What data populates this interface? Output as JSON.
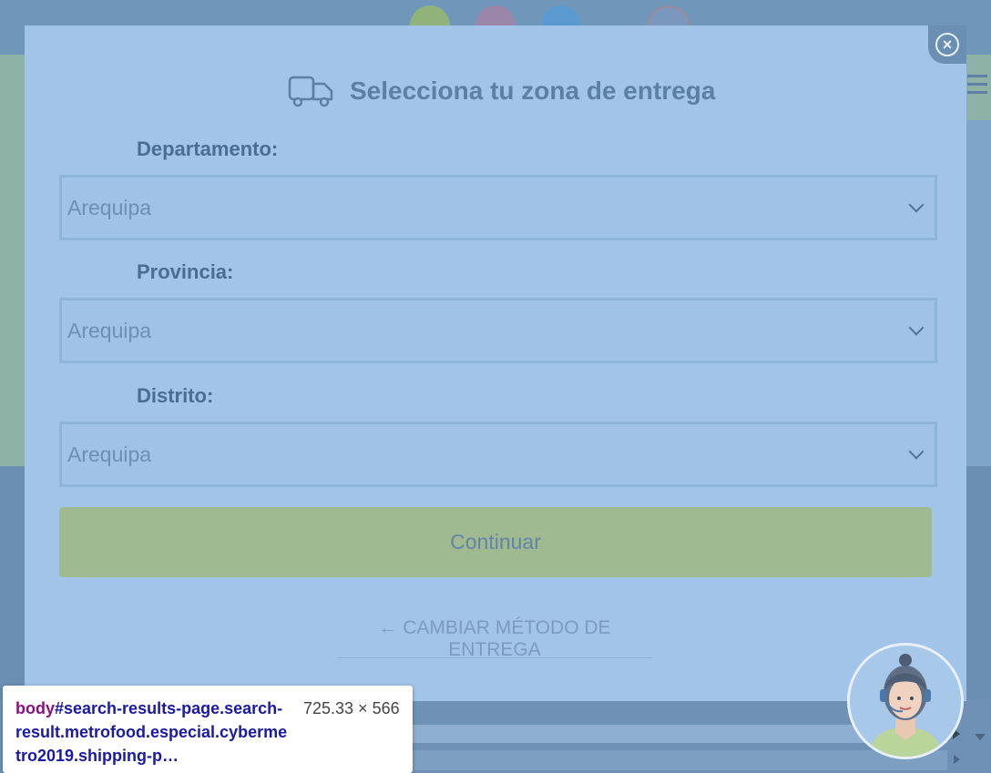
{
  "modal": {
    "title": "Selecciona tu zona de entrega",
    "fields": [
      {
        "label": "Departamento:",
        "value": "Arequipa"
      },
      {
        "label": "Provincia:",
        "value": "Arequipa"
      },
      {
        "label": "Distrito:",
        "value": "Arequipa"
      }
    ],
    "continue_label": "Continuar",
    "change_method_label": "← CAMBIAR MÉTODO DE ENTREGA"
  },
  "devtools_tooltip": {
    "tag": "body",
    "selector": "#search-results-page.search-result.metrofood.especial.cybermetro2019.shipping-p…",
    "dimensions": "725.33 × 566"
  },
  "colors": {
    "overlay_bg": "#6b8fb3",
    "modal_bg": "#a1c4e8",
    "continue_bg": "#9fb990",
    "title_color": "#5c7fa4"
  },
  "icons": {
    "truck": "truck-icon",
    "close": "close-icon",
    "chevron": "chevron-down-icon"
  }
}
